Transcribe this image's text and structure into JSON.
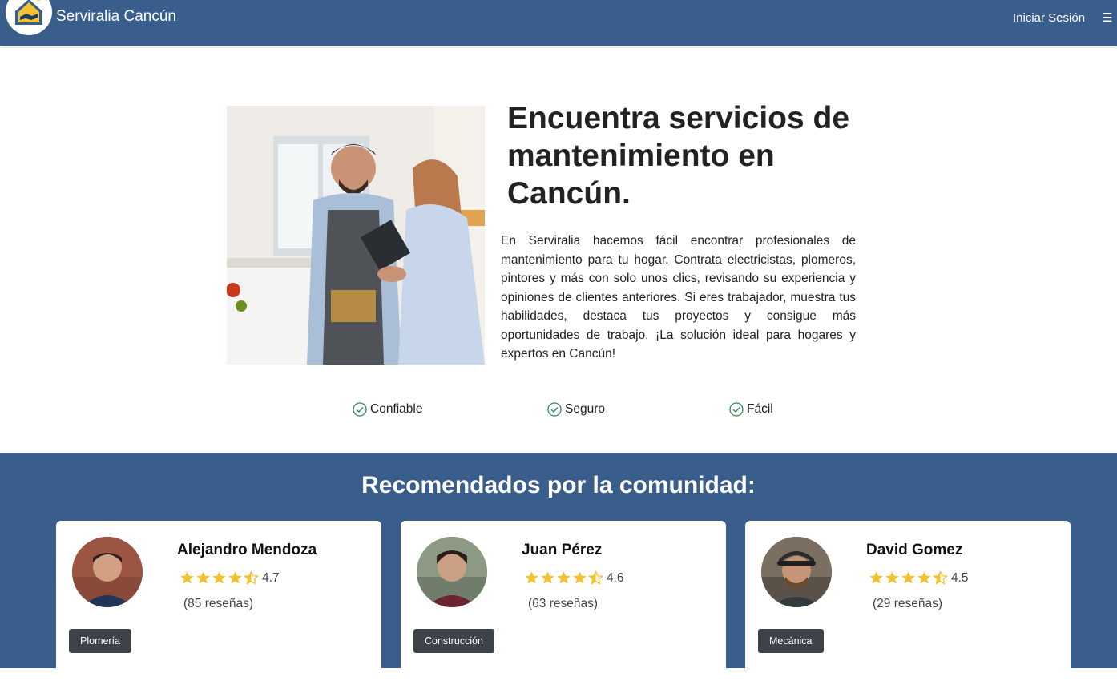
{
  "header": {
    "brand_name": "Serviralia Cancún",
    "login_label": "Iniciar Sesión",
    "menu_glyph": "☰",
    "colors": {
      "primary": "#3a5e8c",
      "accent": "#f2c230"
    }
  },
  "hero": {
    "title": "Encuentra servicios de mantenimiento en Cancún.",
    "description": "En Serviralia hacemos fácil encontrar profesionales de mantenimiento para tu hogar. Contrata electricistas, plomeros, pintores y más con solo unos clics, revisando su experiencia y opiniones de clientes anteriores. Si eres trabajador, muestra tus habilidades, destaca tus proyectos y consigue más oportunidades de trabajo. ¡La solución ideal para hogares y expertos en Cancún!",
    "features": [
      {
        "label": "Confiable",
        "icon": "check-circle-icon"
      },
      {
        "label": "Seguro",
        "icon": "check-circle-icon"
      },
      {
        "label": "Fácil",
        "icon": "check-circle-icon"
      }
    ]
  },
  "recommended": {
    "title": "Recomendados por la comunidad:",
    "workers": [
      {
        "name": "Alejandro Mendoza",
        "rating": "4.7",
        "reviews": "(85 reseñas)",
        "category": "Plomería",
        "stars_full": 4,
        "stars_half": 1
      },
      {
        "name": "Juan Pérez",
        "rating": "4.6",
        "reviews": "(63 reseñas)",
        "category": "Construcción",
        "stars_full": 4,
        "stars_half": 1
      },
      {
        "name": "David Gomez",
        "rating": "4.5",
        "reviews": "(29 reseñas)",
        "category": "Mecánica",
        "stars_full": 4,
        "stars_half": 1
      }
    ]
  }
}
